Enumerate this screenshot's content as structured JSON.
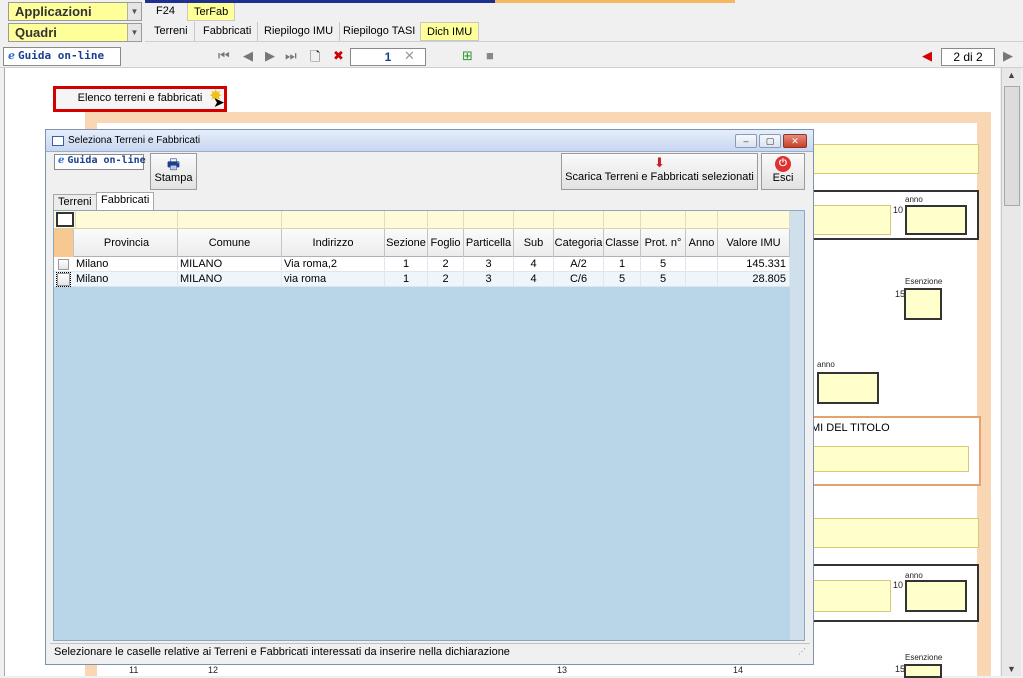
{
  "top": {
    "applicazioni_label": "Applicazioni",
    "quadri_label": "Quadri",
    "tabs_row1": [
      "F24",
      "TerFab"
    ],
    "tabs_row2": [
      "Terreni",
      "Fabbricati",
      "Riepilogo IMU",
      "Riepilogo TASI",
      "Dich IMU"
    ],
    "active_row1": "TerFab",
    "active_row2": "Dich IMU"
  },
  "navbar": {
    "guida_label": "Guida on-line",
    "current_page": "1",
    "page_count": "2 di 2"
  },
  "document": {
    "elenco_button": "Elenco terreni e fabbricati",
    "labels": {
      "anno": "anno",
      "esenzione": "Esenzione",
      "titolo": "MI DEL TITOLO",
      "num10": "10",
      "num15": "15",
      "num11": "11",
      "num12": "12",
      "num13": "13",
      "num14": "14"
    }
  },
  "modal": {
    "title": "Seleziona Terreni e Fabbricati",
    "guida_label": "Guida on-line",
    "stampa_label": "Stampa",
    "scarica_label": "Scarica Terreni e Fabbricati selezionati",
    "esci_label": "Esci",
    "tabs": [
      "Terreni",
      "Fabbricati"
    ],
    "active_tab": "Fabbricati",
    "columns": [
      "Provincia",
      "Comune",
      "Indirizzo",
      "Sezione",
      "Foglio",
      "Particella",
      "Sub",
      "Categoria",
      "Classe",
      "Prot. n°",
      "Anno",
      "Valore IMU"
    ],
    "rows": [
      {
        "provincia": "Milano",
        "comune": "MILANO",
        "indirizzo": "Via roma,2",
        "sezione": "1",
        "foglio": "2",
        "particella": "3",
        "sub": "4",
        "categoria": "A/2",
        "classe": "1",
        "prot": "5",
        "anno": "",
        "valore": "145.331"
      },
      {
        "provincia": "Milano",
        "comune": "MILANO",
        "indirizzo": "via roma",
        "sezione": "1",
        "foglio": "2",
        "particella": "3",
        "sub": "4",
        "categoria": "C/6",
        "classe": "5",
        "prot": "5",
        "anno": "",
        "valore": "28.805"
      }
    ],
    "status": "Selezionare le caselle relative ai Terreni e Fabbricati interessati da inserire nella dichiarazione"
  }
}
